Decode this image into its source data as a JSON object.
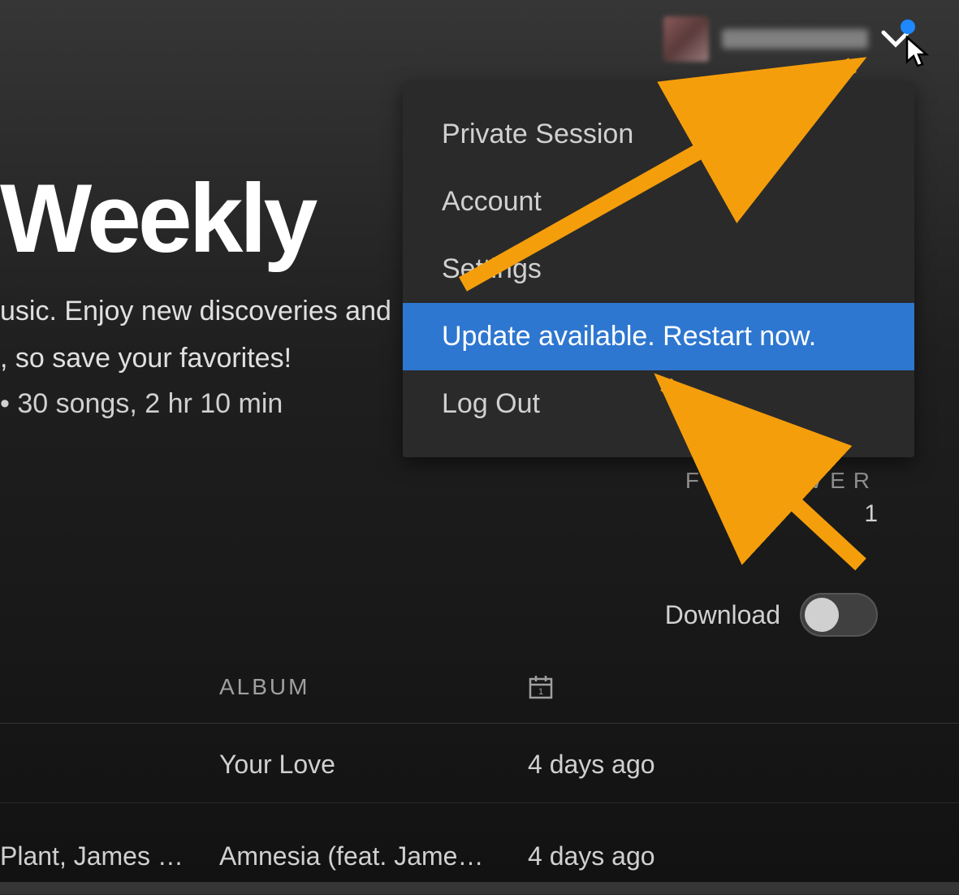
{
  "header": {
    "username": "",
    "avatar_color": "#7a5050"
  },
  "menu": {
    "items": [
      {
        "label": "Private Session",
        "highlighted": false
      },
      {
        "label": "Account",
        "highlighted": false
      },
      {
        "label": "Settings",
        "highlighted": false
      },
      {
        "label": "Update available. Restart now.",
        "highlighted": true
      },
      {
        "label": "Log Out",
        "highlighted": false
      }
    ]
  },
  "page": {
    "title": "Weekly",
    "subtitle_line1": "usic. Enjoy new discoveries and",
    "subtitle_line2": ", so save your favorites!",
    "meta": "• 30 songs, 2 hr 10 min",
    "follower_label": "FOLLOWER",
    "follower_count": "1",
    "download_label": "Download",
    "download_on": false
  },
  "table": {
    "columns": {
      "album": "ALBUM"
    },
    "rows": [
      {
        "artist": "",
        "album": "Your Love",
        "date": "4 days ago"
      },
      {
        "artist": "Plant, James …",
        "album": "Amnesia (feat. Jame…",
        "date": "4 days ago"
      }
    ]
  },
  "colors": {
    "accent": "#2e77d0",
    "notification": "#1e88ff",
    "arrow": "#f59e0b"
  }
}
